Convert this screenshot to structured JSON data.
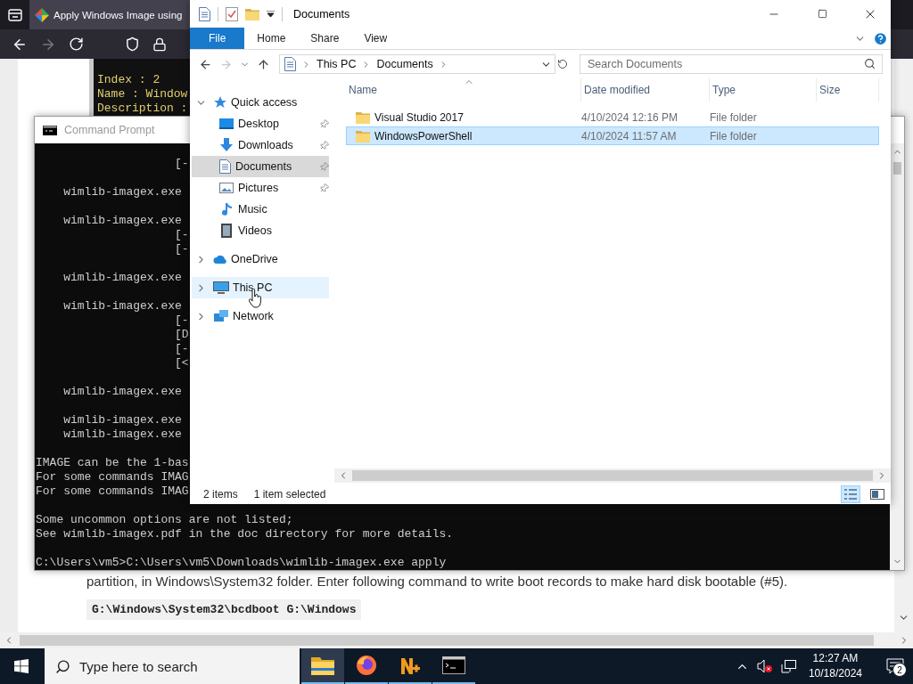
{
  "browser": {
    "tab_title": "Apply Windows Image using",
    "page": {
      "code_lines": [
        "Index : 2",
        "Name : Window",
        "Description :"
      ],
      "paragraph": "partition, in Windows\\System32 folder. Enter following command to write boot records to make hard disk bootable (#5).",
      "command": "G:\\Windows\\System32\\bcdboot G:\\Windows"
    }
  },
  "command_prompt": {
    "title": "Command Prompt",
    "blocks": [
      [
        "                    [-"
      ],
      [
        "    wimlib-imagex.exe"
      ],
      [
        "    wimlib-imagex.exe",
        "                    [-",
        "                    [-"
      ],
      [
        "    wimlib-imagex.exe"
      ],
      [
        "    wimlib-imagex.exe",
        "                    [-",
        "                    [D",
        "                    [-",
        "                    [<"
      ],
      [
        "    wimlib-imagex.exe"
      ],
      [
        "    wimlib-imagex.exe",
        "    wimlib-imagex.exe"
      ],
      [
        "IMAGE can be the 1-bas",
        "For some commands IMAG",
        "For some commands IMAG"
      ],
      [
        "Some uncommon options are not listed;",
        "See wimlib-imagex.pdf in the doc directory for more details."
      ],
      [
        "C:\\Users\\vm5>C:\\Users\\vm5\\Downloads\\wimlib-imagex.exe apply"
      ]
    ]
  },
  "explorer": {
    "title": "Documents",
    "ribbon_tabs": [
      {
        "label": "File",
        "kind": "menu"
      },
      {
        "label": "Home",
        "kind": "tab"
      },
      {
        "label": "Share",
        "kind": "tab"
      },
      {
        "label": "View",
        "kind": "tab"
      }
    ],
    "address": [
      "This PC",
      "Documents"
    ],
    "search": {
      "placeholder": "Search Documents"
    },
    "nav": [
      {
        "label": "Quick access",
        "kind": "star",
        "expanded": true,
        "selected": false,
        "hovered": false,
        "pinned": false,
        "children": [
          {
            "label": "Desktop",
            "kind": "desktop",
            "selected": false,
            "hovered": false,
            "pinned": true
          },
          {
            "label": "Downloads",
            "kind": "downloads",
            "selected": false,
            "hovered": false,
            "pinned": true
          },
          {
            "label": "Documents",
            "kind": "documents",
            "selected": true,
            "hovered": false,
            "pinned": true
          },
          {
            "label": "Pictures",
            "kind": "pictures",
            "selected": false,
            "hovered": false,
            "pinned": true
          },
          {
            "label": "Music",
            "kind": "music",
            "selected": false,
            "hovered": false,
            "pinned": false
          },
          {
            "label": "Videos",
            "kind": "videos",
            "selected": false,
            "hovered": false,
            "pinned": false
          }
        ]
      },
      {
        "label": "OneDrive",
        "kind": "cloud",
        "expanded": false,
        "selected": false,
        "hovered": false,
        "pinned": false
      },
      {
        "label": "This PC",
        "kind": "computer",
        "expanded": false,
        "selected": false,
        "hovered": true,
        "pinned": false
      },
      {
        "label": "Network",
        "kind": "network",
        "expanded": false,
        "selected": false,
        "hovered": false,
        "pinned": false
      }
    ],
    "columns": [
      {
        "label": "Name",
        "sorted": true
      },
      {
        "label": "Date modified",
        "sorted": false
      },
      {
        "label": "Type",
        "sorted": false
      },
      {
        "label": "Size",
        "sorted": false
      }
    ],
    "rows": [
      {
        "name": "Visual Studio 2017",
        "date": "4/10/2024 12:16 PM",
        "type": "File folder",
        "selected": false
      },
      {
        "name": "WindowsPowerShell",
        "date": "4/10/2024 11:57 AM",
        "type": "File folder",
        "selected": true
      }
    ],
    "status": {
      "count": "2 items",
      "selection": "1 item selected"
    },
    "views": [
      {
        "kind": "details",
        "selected": true
      },
      {
        "kind": "preview",
        "selected": false
      }
    ]
  },
  "taskbar": {
    "search": {
      "placeholder": "Type here to search"
    },
    "apps": [
      {
        "kind": "explorer",
        "selected": true
      },
      {
        "kind": "firefox",
        "selected": false
      },
      {
        "kind": "app",
        "selected": false
      },
      {
        "kind": "terminal",
        "selected": false
      }
    ],
    "time": "12:27 AM",
    "date": "10/18/2024",
    "notifications": "2"
  }
}
